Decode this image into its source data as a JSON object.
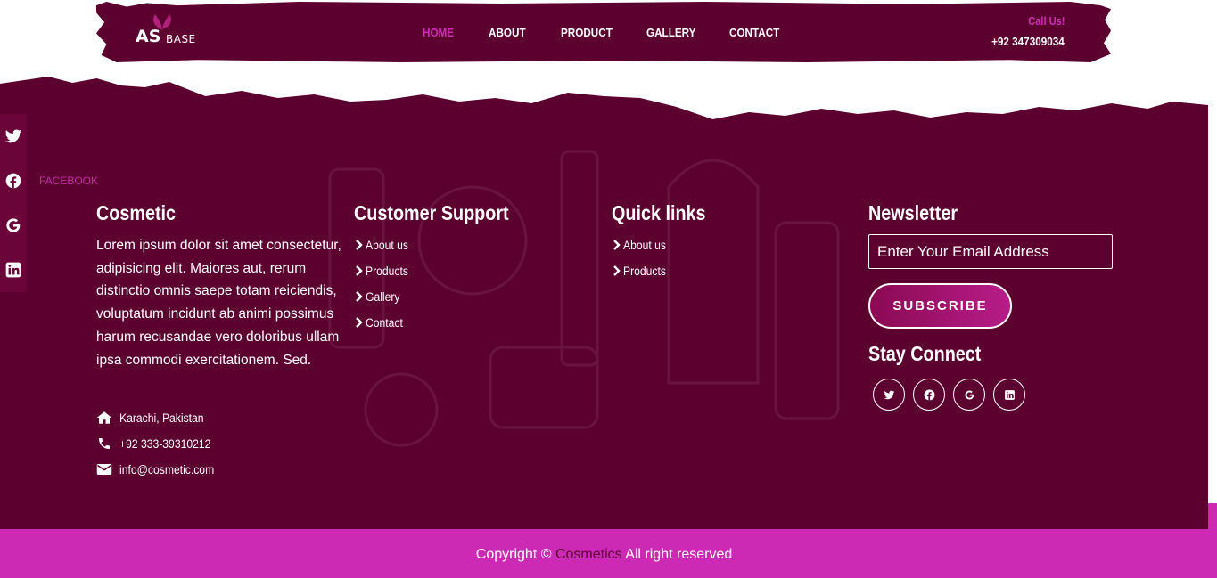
{
  "header": {
    "logo": {
      "primary": "AS",
      "secondary": "BASE"
    },
    "nav": [
      "HOME",
      "ABOUT",
      "PRODUCT",
      "GALLERY",
      "CONTACT"
    ],
    "active_nav": "HOME",
    "call_label": "Call Us!",
    "call_phone": "+92 347309034"
  },
  "sidebar": {
    "icons": [
      "twitter-icon",
      "facebook-icon",
      "google-icon",
      "linkedin-icon"
    ],
    "hover_label": "FACEBOOK"
  },
  "footer": {
    "cosmetic": {
      "title": "Cosmetic",
      "text": "Lorem ipsum dolor sit amet consectetur, adipisicing elit. Maiores aut, rerum distinctio omnis saepe totam reiciendis, voluptatum incidunt ab animi possimus harum recusandae vero doloribus ullam ipsa commodi exercitationem. Sed.",
      "address": "Karachi, Pakistan",
      "phone": "+92 333-39310212",
      "email": "info@cosmetic.com"
    },
    "support": {
      "title": "Customer Support",
      "links": [
        "About us",
        "Products",
        "Gallery",
        "Contact"
      ]
    },
    "quick": {
      "title": "Quick links",
      "links": [
        "About us",
        "Products"
      ]
    },
    "newsletter": {
      "title": "Newsletter",
      "placeholder": "Enter Your Email Address",
      "button": "SUBSCRIBE",
      "connect_title": "Stay Connect",
      "social": [
        "twitter-icon",
        "facebook-icon",
        "google-icon",
        "linkedin-icon"
      ]
    }
  },
  "copyright": {
    "prefix": "Copyright ©",
    "brand": "Cosmetics",
    "suffix": "All right reserved"
  },
  "colors": {
    "maroon": "#5c0030",
    "magenta": "#cc29b4",
    "accent": "#d22bb8",
    "white": "#ffffff"
  }
}
